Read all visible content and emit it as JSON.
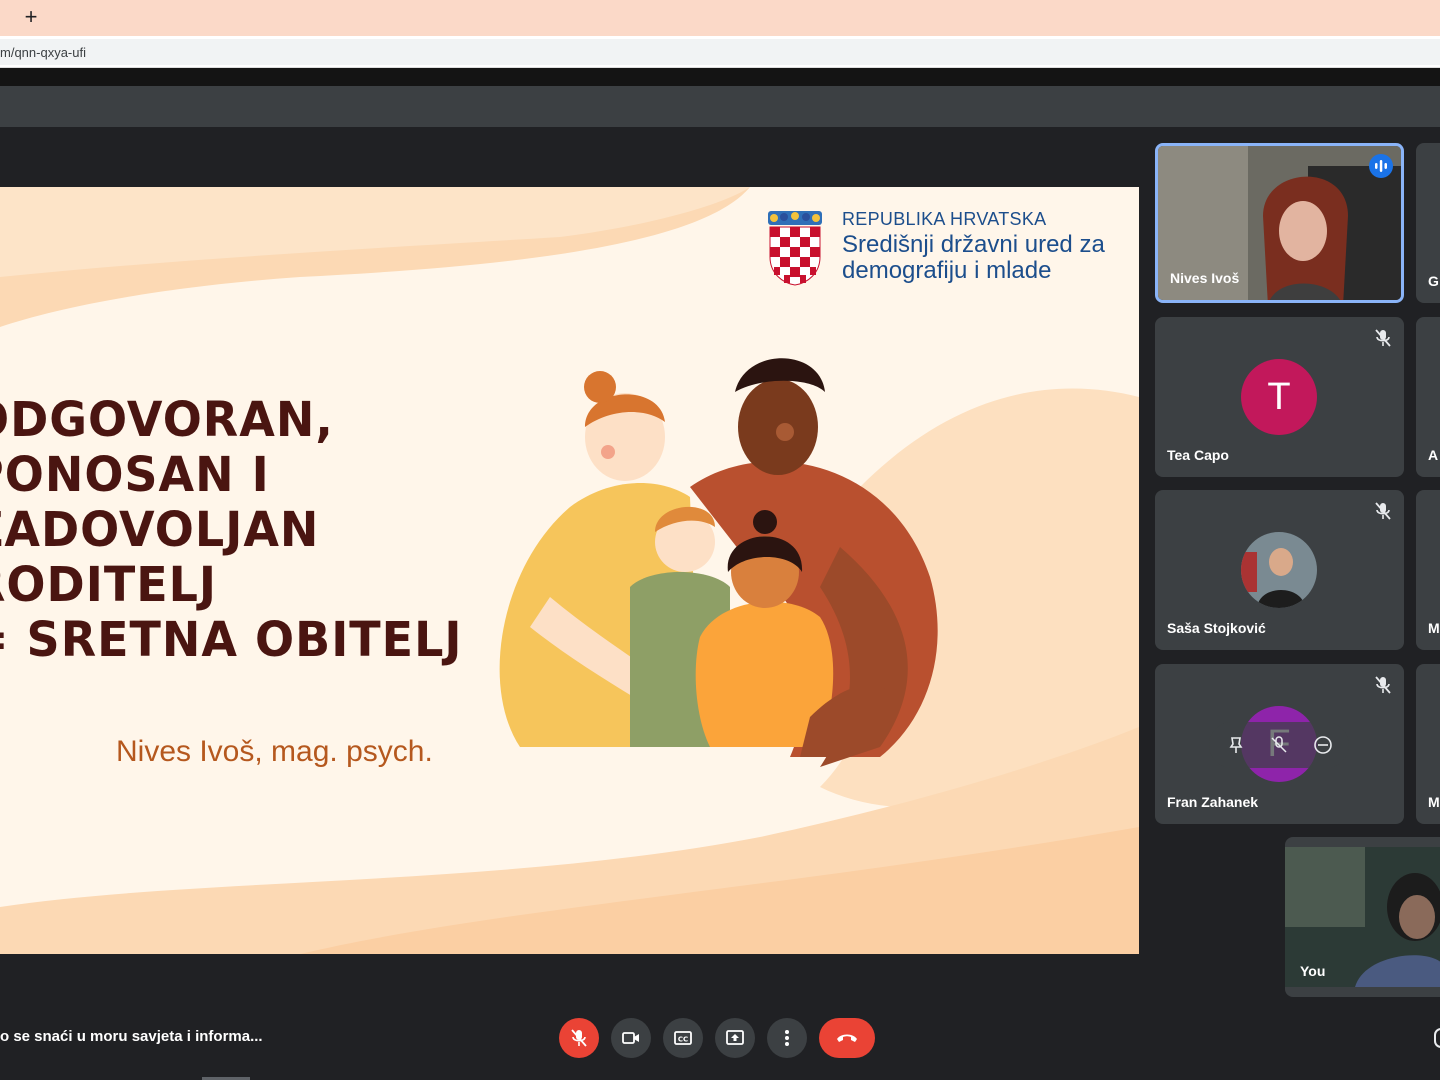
{
  "browser": {
    "new_tab_label": "+",
    "url": "m/qnn-qxya-ufi"
  },
  "slide": {
    "gov_line1": "REPUBLIKA HRVATSKA",
    "gov_line2": "Središnji državni ured za",
    "gov_line3": "demografiju i mlade",
    "title_lines": [
      "ODGOVORAN,",
      "PONOSAN I",
      "ZADOVOLJAN",
      "RODITELJ",
      "= SRETNA OBITELJ"
    ],
    "author": "Nives Ivoš, mag. psych."
  },
  "participants": [
    {
      "name": "Nives Ivoš",
      "state": "speaking"
    },
    {
      "name": "Tea Capo",
      "avatar_letter": "T",
      "avatar_color": "#c2185b",
      "state": "muted"
    },
    {
      "name": "Saša Stojković",
      "state": "muted"
    },
    {
      "name": "Fran Zahanek",
      "avatar_letter": "F",
      "avatar_color": "#8e24aa",
      "state": "muted"
    }
  ],
  "side_participants": [
    "G",
    "A",
    "M",
    "M"
  ],
  "self": {
    "name": "You"
  },
  "meeting": {
    "title": "o se snaći u moru savjeta i informa..."
  },
  "colors": {
    "accent": "#1a73e8",
    "danger": "#ea4335",
    "slide_title": "#4a1511",
    "slide_author": "#b5581e",
    "gov_blue": "#1c4e8c"
  }
}
